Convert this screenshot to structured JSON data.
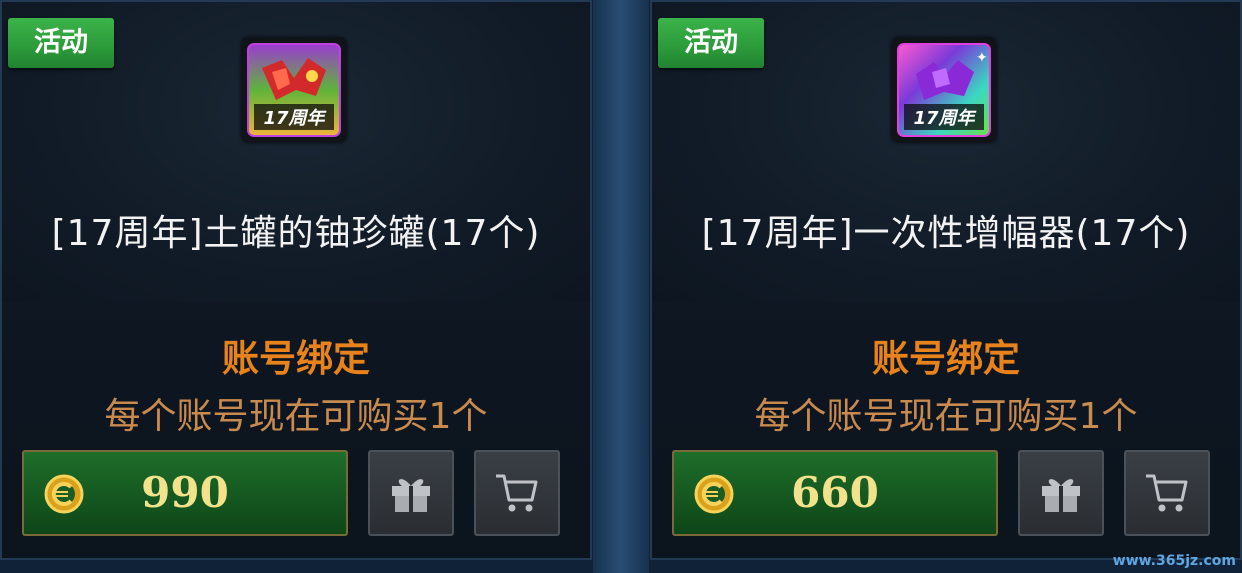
{
  "cards": [
    {
      "badge": "活动",
      "icon": "jar-item-icon",
      "title": "[17周年]土罐的铀珍罐(17个)",
      "bound": "账号绑定",
      "limit": "每个账号现在可购买1个",
      "price": "990"
    },
    {
      "badge": "活动",
      "icon": "amplifier-item-icon",
      "title": "[17周年]一次性增幅器(17个)",
      "bound": "账号绑定",
      "limit": "每个账号现在可购买1个",
      "price": "660"
    }
  ],
  "icons": {
    "coin": "coin-icon",
    "gift": "gift-icon",
    "cart": "cart-icon"
  },
  "watermark": "www.365jz.com",
  "colors": {
    "badge_green": "#2c9a3a",
    "bound_orange": "#e8821a",
    "limit_orange": "#c98a4e",
    "price_yellow": "#f3e28c",
    "price_button_green": "#165a21"
  }
}
